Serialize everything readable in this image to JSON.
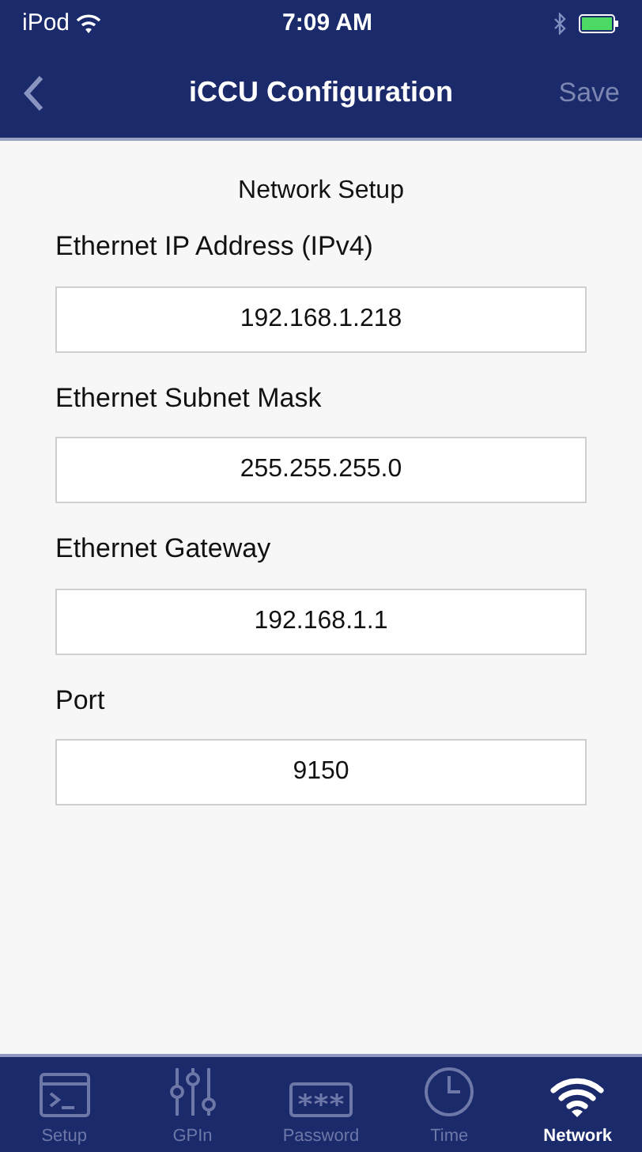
{
  "status_bar": {
    "carrier": "iPod",
    "time": "7:09 AM"
  },
  "nav": {
    "title": "iCCU Configuration",
    "action": "Save",
    "action_disabled": true
  },
  "section_title": "Network Setup",
  "fields": [
    {
      "label": "Ethernet IP Address (IPv4)",
      "value": "192.168.1.218"
    },
    {
      "label": "Ethernet Subnet Mask",
      "value": "255.255.255.0"
    },
    {
      "label": "Ethernet Gateway",
      "value": "192.168.1.1"
    },
    {
      "label": "Port",
      "value": "9150"
    }
  ],
  "tabs": [
    {
      "kind": "terminal",
      "label": "Setup",
      "selected": false
    },
    {
      "kind": "sliders",
      "label": "GPIn",
      "selected": false
    },
    {
      "kind": "password",
      "label": "Password",
      "selected": false
    },
    {
      "kind": "clock",
      "label": "Time",
      "selected": false
    },
    {
      "kind": "wifi",
      "label": "Network",
      "selected": true
    }
  ]
}
